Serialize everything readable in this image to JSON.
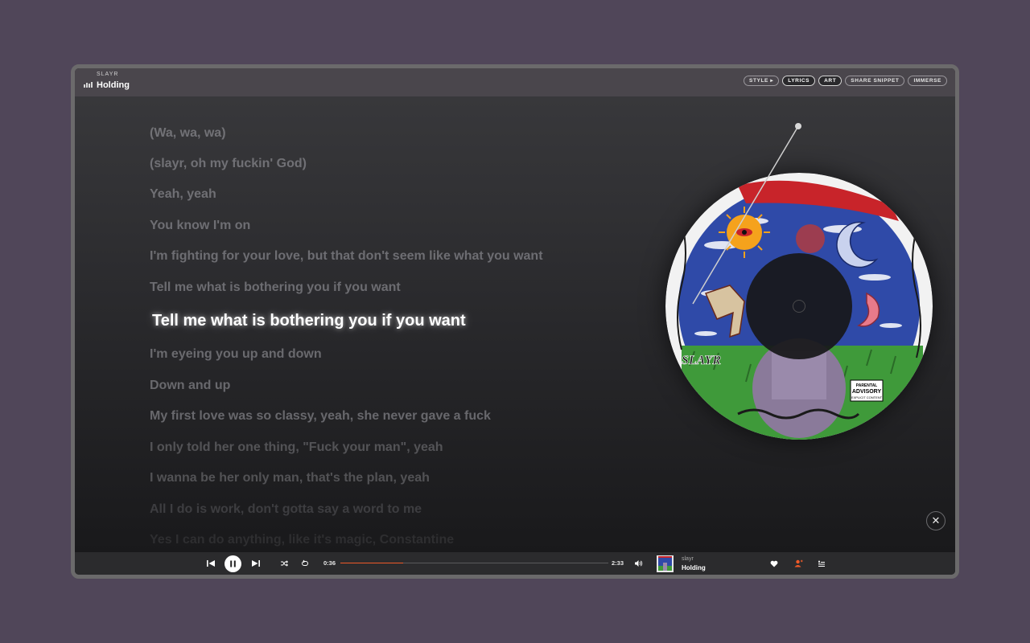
{
  "header": {
    "artist": "SLAYR",
    "title": "Holding",
    "buttons": [
      {
        "label": "STYLE ▸",
        "active": false
      },
      {
        "label": "LYRICS",
        "active": true
      },
      {
        "label": "ART",
        "active": true
      },
      {
        "label": "SHARE SNIPPET",
        "active": false
      },
      {
        "label": "IMMERSE",
        "active": false
      }
    ]
  },
  "lyrics": {
    "lines": [
      "(Wa, wa, wa)",
      "(slayr, oh my fuckin' God)",
      "Yeah, yeah",
      "You know I'm on",
      "I'm fighting for your love, but that don't seem like what you want",
      "Tell me what is bothering you if you want",
      "Tell me what is bothering you if you want",
      "I'm eyeing you up and down",
      "Down and up",
      "My first love was so classy, yeah, she never gave a fuck",
      "I only told her one thing, \"Fuck your man\", yeah",
      "I wanna be her only man, that's the plan, yeah",
      "All I do is work, don't gotta say a word to me",
      "Yes I can do anything, like it's magic, Constantine"
    ],
    "current_index": 6
  },
  "album_art": {
    "band_text": "SLAYR",
    "sticker_line1": "PARENTAL",
    "sticker_line2": "ADVISORY",
    "sticker_line3": "EXPLICIT CONTENT",
    "colors": {
      "sky": "#2f4aa8",
      "grass": "#3f9a3a",
      "frame": "#f2f2f2",
      "blood": "#c8242a",
      "sun": "#f5a21c"
    }
  },
  "player": {
    "elapsed": "0:36",
    "duration": "2:33",
    "progress": 0.235,
    "track_artist": "slayr",
    "track_title": "Holding",
    "accent": "#f05a28",
    "icons": [
      "previous-icon",
      "pause-icon",
      "next-icon",
      "shuffle-icon",
      "repeat-icon",
      "volume-icon",
      "heart-icon",
      "follow-artist-icon",
      "queue-icon"
    ]
  },
  "close_label": "✕"
}
